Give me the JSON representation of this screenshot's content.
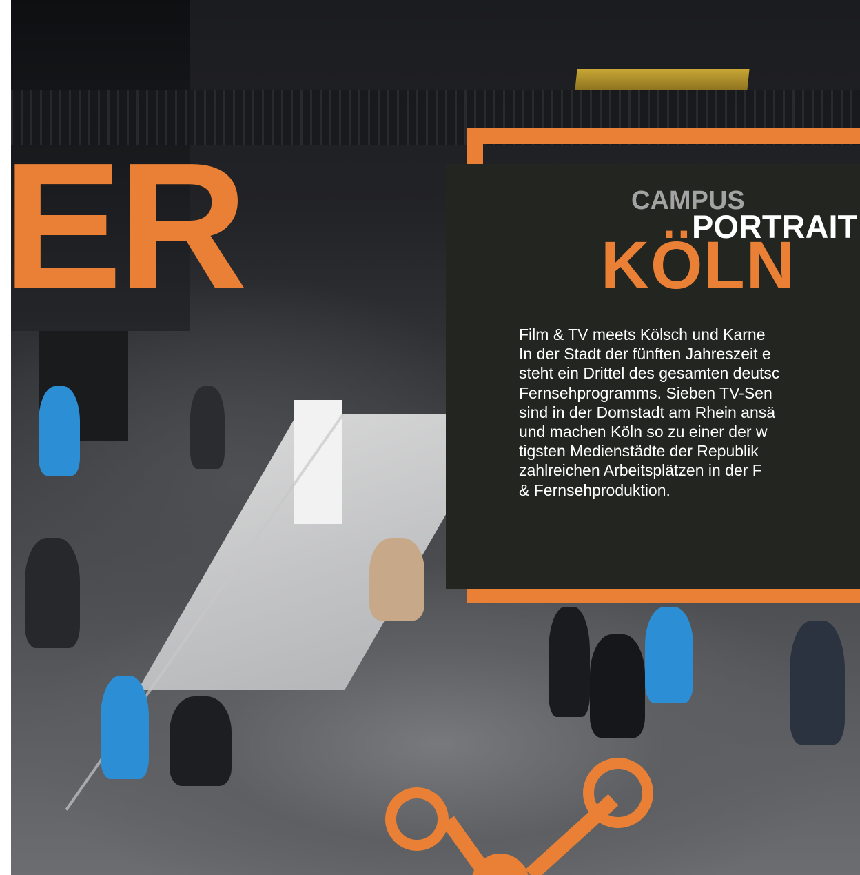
{
  "page": {
    "heading_fragment": "ER"
  },
  "infobox": {
    "title_line1": "CAMPUS",
    "title_line2": "PORTRAIT",
    "title_city": "KÖLN",
    "body": "Film & TV meets Kölsch und Karne\nIn der Stadt der fünften Jahreszeit e\nsteht ein Drittel des gesamten deutsc\nFernsehprogramms. Sieben TV-Sen\nsind in der Domstadt am Rhein ansä\nund machen Köln so zu einer der w\ntigsten Medienstädte der Republik\nzahlreichen Arbeitsplätzen in der F\n& Fernsehproduktion."
  },
  "colors": {
    "accent": "#e98035",
    "box_background": "#232520",
    "title_gray": "#a3a3a3",
    "text": "#ffffff"
  },
  "icons": {
    "network_graphic": "network-nodes-icon"
  }
}
